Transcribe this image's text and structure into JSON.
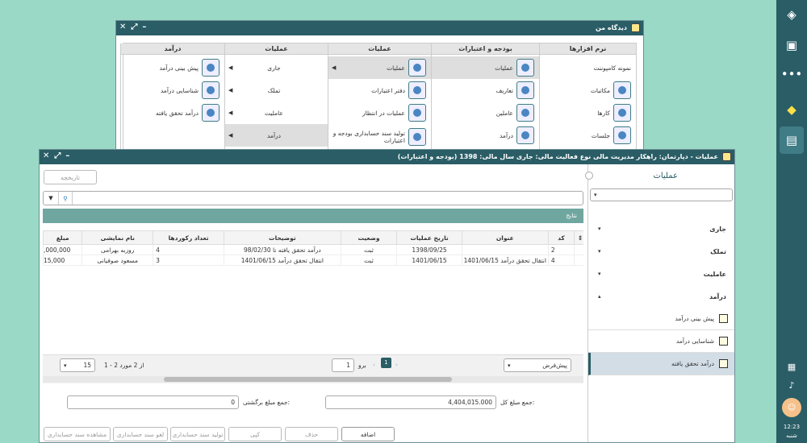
{
  "sidebar": {
    "time": "12:23",
    "day": "شنبه"
  },
  "back_window": {
    "title": "دیدگاه من",
    "columns": [
      {
        "header": "نرم افزارها",
        "items": [
          "نمونه کامپوننت",
          "مکاتبات",
          "کارها",
          "جلسات"
        ]
      },
      {
        "header": "بودجه و اعتبارات",
        "items": [
          "عملیات",
          "تعاریف",
          "عاملین",
          "درآمد"
        ]
      },
      {
        "header": "عملیات",
        "items": [
          "عملیات",
          "دفتر اعتبارات",
          "عملیات در انتظار",
          "تولید سند حسابداری بودجه و اعتبارات"
        ]
      },
      {
        "header": "عملیات",
        "items": [
          "جاری",
          "تملک",
          "عاملیت",
          "درآمد"
        ]
      },
      {
        "header": "درآمد",
        "items": [
          "پیش بینی درآمد",
          "شناسایی درآمد",
          "درآمد تحقق یافته"
        ]
      }
    ]
  },
  "front_window": {
    "title": "عملیات - دپارتمان: راهکار مدیریت مالی نوع فعالیت مالی: جاری سال مالی: 1398 (بودجه و اعتبارات)",
    "history_button": "تاریخچه",
    "results_label": "نتایج",
    "table": {
      "headers": [
        "کد",
        "عنوان",
        "تاریخ عملیات",
        "وضعیت",
        "توضیحات",
        "تعداد رکوردها",
        "نام نمایشی",
        "مبلغ"
      ],
      "rows": [
        [
          "2",
          "",
          "1398/09/25",
          "ثبت",
          "درآمد تحقق یافته تا 98/02/30",
          "4",
          "روزبه بهرامی",
          "000,000,"
        ],
        [
          "4",
          "انتقال تحقق درآمد 1401/06/15",
          "1401/06/15",
          "ثبت",
          "انتقال تحقق درآمد 1401/06/15",
          "3",
          "مسعود صوفیانی",
          "15,000"
        ]
      ]
    },
    "pager": {
      "view": "پیش‌فرض",
      "current": "1",
      "goto": "برو",
      "goto_value": "1",
      "summary": "1 - 2 از 2 مورد",
      "page_size": "15"
    },
    "totals": {
      "total_label": "جمع مبلغ کل:",
      "total_value": "4,404,015.000",
      "return_label": "جمع مبلغ برگشتی:",
      "return_value": "0"
    },
    "buttons": [
      "اضافه",
      "حذف",
      "کپی",
      "تولید سند حسابداری",
      "لغو سند حسابداری",
      "مشاهده سند حسابداری"
    ],
    "side_panel": {
      "title": "عملیات",
      "tree": [
        "جاری",
        "تملک",
        "عاملیت",
        "درآمد"
      ],
      "sub_items": [
        "پیش بینی درآمد",
        "شناسایی درآمد",
        "درآمد تحقق یافته"
      ]
    }
  }
}
